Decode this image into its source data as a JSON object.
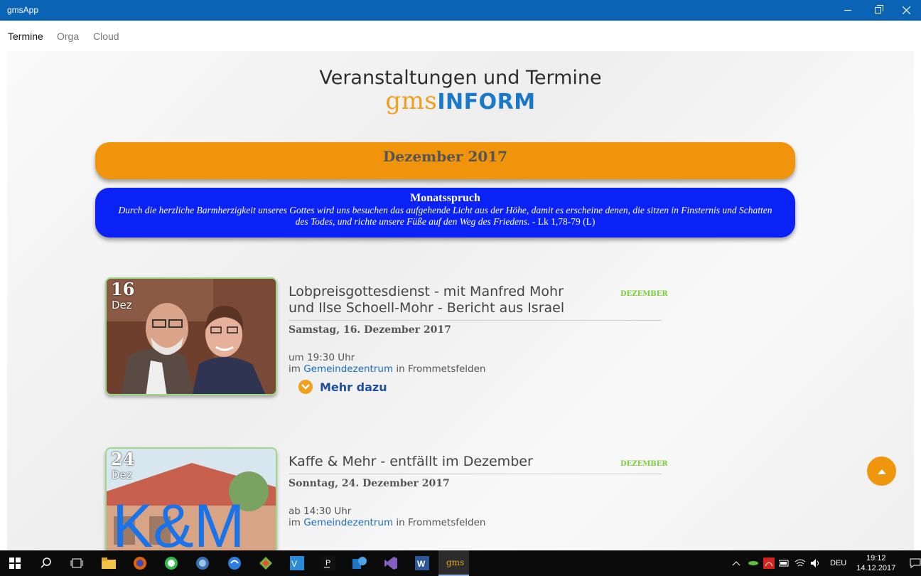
{
  "window": {
    "title": "gmsApp"
  },
  "nav": {
    "items": [
      "Termine",
      "Orga",
      "Cloud"
    ],
    "active": "Termine"
  },
  "header": {
    "title": "Veranstaltungen und Termine",
    "logo_part1": "gms",
    "logo_part2": "INFORM"
  },
  "month_banner": "Dezember 2017",
  "monatsspruch": {
    "heading": "Monatsspruch",
    "text": "Durch die herzliche Barmherzigkeit unseres Gottes wird uns besuchen das aufgehende Licht aus der Höhe, damit es erscheine denen, die sitzen in Finsternis und Schatten des Todes, und richte unsere Füße auf den Weg des Friedens.",
    "reference": " - Lk 1,78-79 (L)"
  },
  "events": [
    {
      "day": "16",
      "month": "Dez",
      "title": "Lobpreisgottesdienst - mit Manfred Mohr und Ilse Schoell-Mohr - Bericht aus Israel",
      "badge": "DEZEMBER",
      "date": "Samstag, 16. Dezember 2017",
      "time": "um 19:30 Uhr",
      "loc_prefix": "im",
      "loc_link": "Gemeindezentrum",
      "loc_suffix": "in Frommetsfelden",
      "more_label": "Mehr dazu"
    },
    {
      "day": "24",
      "month": "Dez",
      "title": "Kaffe & Mehr - entfällt im Dezember",
      "badge": "DEZEMBER",
      "date": "Sonntag, 24. Dezember 2017",
      "time": "ab 14:30 Uhr",
      "loc_prefix": "im",
      "loc_link": "Gemeindezentrum",
      "loc_suffix": "in Frommetsfelden",
      "image_text": "K&M"
    }
  ],
  "taskbar": {
    "active_app": "gms",
    "language": "DEU",
    "time": "19:12",
    "date": "14.12.2017"
  },
  "colors": {
    "titlebar": "#0b63b6",
    "month_banner": "#f0940b",
    "spruch_bg": "#0a22f5",
    "badge": "#7ccf3a",
    "link": "#1a6cc0"
  }
}
